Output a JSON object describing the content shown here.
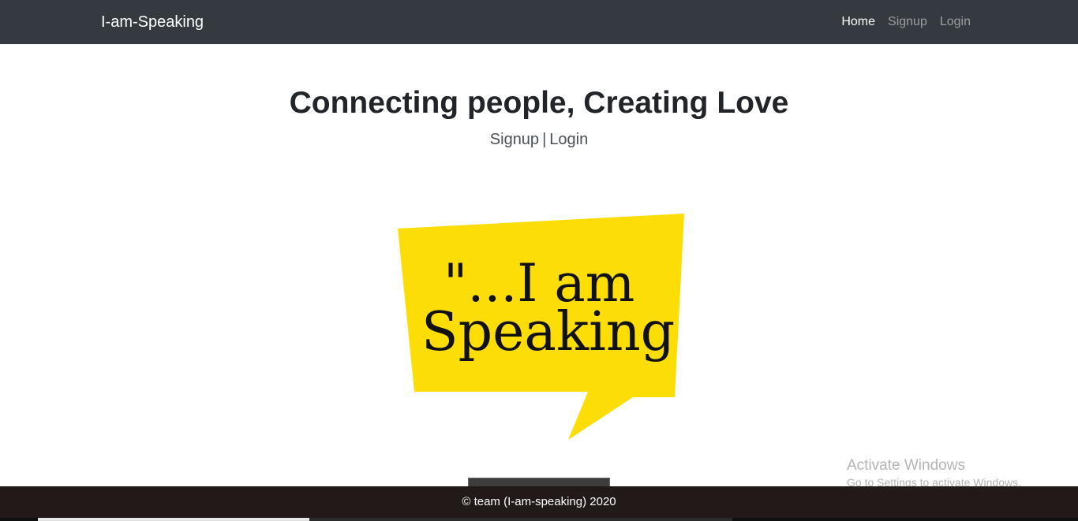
{
  "navbar": {
    "brand": "I-am-Speaking",
    "links": [
      {
        "label": "Home",
        "active": true
      },
      {
        "label": "Signup",
        "active": false
      },
      {
        "label": "Login",
        "active": false
      }
    ]
  },
  "hero": {
    "title": "Connecting people, Creating Love",
    "signup_label": "Signup",
    "separator": "|",
    "login_label": "Login"
  },
  "logo": {
    "line1": "\"...I am",
    "line2": "Speaking",
    "bubble_color": "#fddd06"
  },
  "watermark": {
    "line1": "Activate Windows",
    "line2": "Go to Settings to activate Windows."
  },
  "footer": {
    "text": "© team (I-am-speaking) 2020"
  },
  "colors": {
    "navbar_bg": "#343a40",
    "footer_bg": "#221a19"
  }
}
